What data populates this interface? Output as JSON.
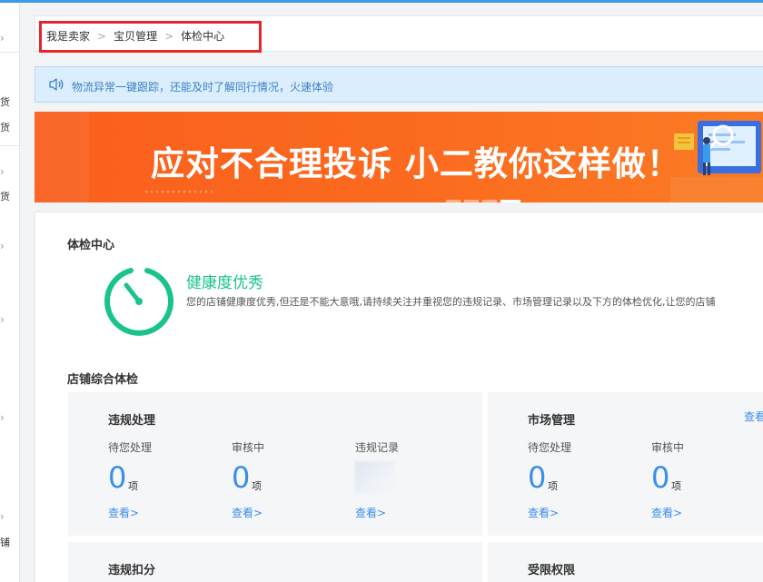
{
  "sidebar": {
    "fragments": [
      "货",
      "货",
      "货",
      "铺"
    ]
  },
  "breadcrumb": {
    "items": [
      "我是卖家",
      "宝贝管理",
      "体检中心"
    ],
    "separator": ">"
  },
  "notice": {
    "text": "物流异常一键跟踪，还能及时了解同行情况，火速体验"
  },
  "banner": {
    "title": "应对不合理投诉 小二教你这样做！",
    "slide_count": 4,
    "active_slide": 4
  },
  "health": {
    "section_title": "体检中心",
    "status": "健康度优秀",
    "description": "您的店铺健康度优秀,但还是不能大意哦,请持续关注并重视您的违规记录、市场管理记录以及下方的体检优化,让您的店铺",
    "gauge_color": "#19c38b"
  },
  "inspection": {
    "section_title": "店铺综合体检",
    "violation": {
      "title": "违规处理",
      "pending_label": "待您处理",
      "pending_value": "0",
      "review_label": "审核中",
      "review_value": "0",
      "record_label": "违规记录",
      "unit": "项",
      "link": "查看>"
    },
    "market": {
      "title": "市场管理",
      "pending_label": "待您处理",
      "pending_value": "0",
      "review_label": "审核中",
      "review_value": "0",
      "unit": "项",
      "link": "查看>",
      "edge_link": "查看"
    },
    "deduction": {
      "title": "违规扣分"
    },
    "restriction": {
      "title": "受限权限"
    }
  },
  "colors": {
    "accent": "#3b8ee8",
    "banner": "#fb6a1f",
    "highlight_box": "#e8232d"
  }
}
